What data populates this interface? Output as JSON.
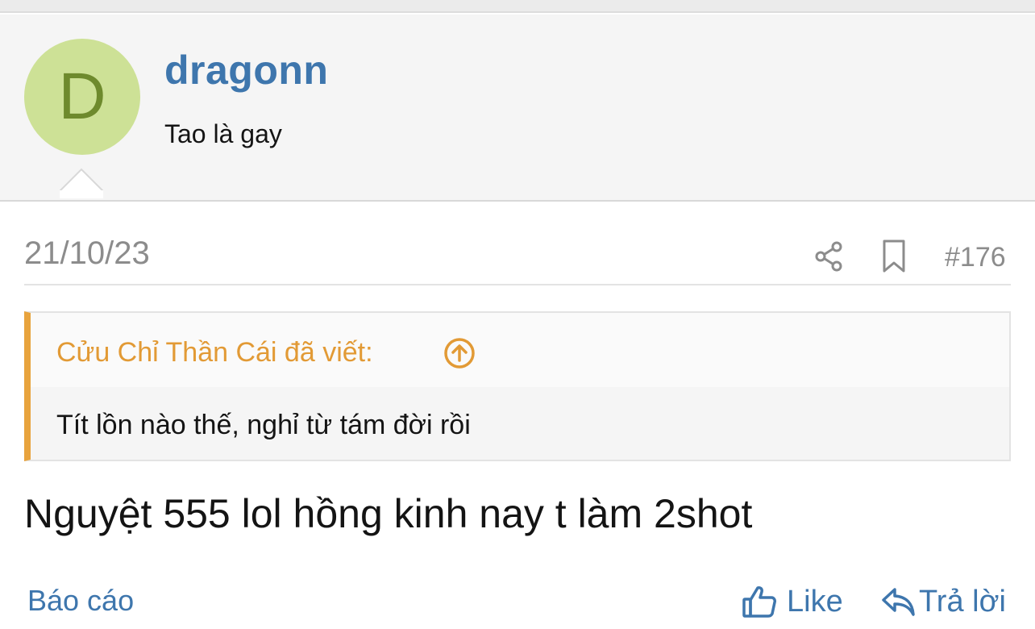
{
  "user": {
    "avatar_letter": "D",
    "name": "dragonn",
    "title": "Tao là gay",
    "avatar_color": "#cde196"
  },
  "post": {
    "date": "21/10/23",
    "number": "#176",
    "icons": [
      "share-icon",
      "bookmark-icon"
    ],
    "quote": {
      "author": "Cửu Chỉ Thần Cái đã viết:",
      "text": "Tít lồn nào thế, nghỉ từ tám đời rồi",
      "accent_color": "#e8a33d"
    },
    "text": "Nguyệt 555 lol hồng kinh nay t làm 2shot"
  },
  "actions": {
    "report_label": "Báo cáo",
    "like_label": "Like",
    "reply_label": "Trả lời"
  },
  "colors": {
    "link": "#3e76ad",
    "muted": "#8c8c8c"
  }
}
